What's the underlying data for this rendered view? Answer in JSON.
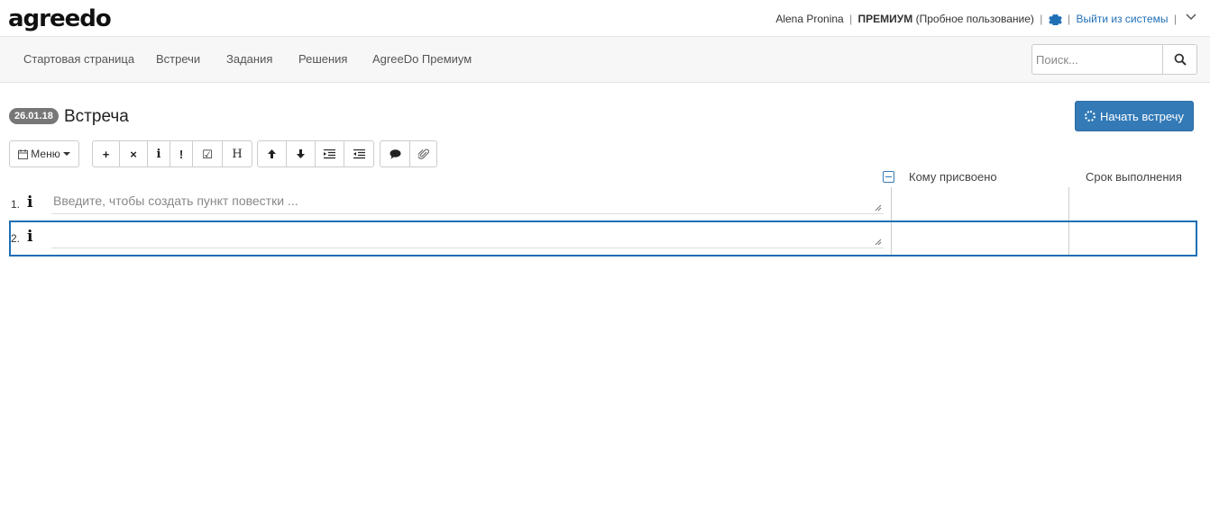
{
  "app": {
    "logo_text": "agreedo"
  },
  "user_bar": {
    "user_name": "Alena Pronina",
    "sep": "|",
    "plan": "ПРЕМИУМ",
    "plan_note": "(Пробное пользование)",
    "logout_label": "Выйти из системы",
    "settings_icon": "gear-icon",
    "menu_icon": "chevron-down-icon"
  },
  "nav": {
    "items": [
      {
        "label": "Стартовая страница"
      },
      {
        "label": "Встречи"
      },
      {
        "label": "Задания"
      },
      {
        "label": "Решения"
      },
      {
        "label": "AgreeDo Премиум"
      }
    ],
    "search_placeholder": "Поиск...",
    "search_icon": "search-icon"
  },
  "meeting": {
    "date_badge": "26.01.18",
    "title": "Встреча",
    "start_button_label": "Начать встречу"
  },
  "toolbar": {
    "menu_label": "Меню",
    "buttons": [
      {
        "icon": "plus-icon",
        "glyph": "+"
      },
      {
        "icon": "remove-icon",
        "glyph": "×"
      },
      {
        "icon": "info-icon",
        "glyph": "i"
      },
      {
        "icon": "exclamation-icon",
        "glyph": "!"
      },
      {
        "icon": "checkbox-icon",
        "glyph": "☑"
      },
      {
        "icon": "heading-icon",
        "glyph": "H"
      },
      {
        "icon": "arrow-up-icon",
        "glyph": "🡑"
      },
      {
        "icon": "arrow-down-icon",
        "glyph": "🡓"
      },
      {
        "icon": "indent-icon",
        "glyph": "⇥"
      },
      {
        "icon": "outdent-icon",
        "glyph": "⇤"
      },
      {
        "icon": "comment-icon",
        "glyph": "💬"
      },
      {
        "icon": "paperclip-icon",
        "glyph": "📎"
      }
    ]
  },
  "table": {
    "headers": {
      "assigned_to": "Кому присвоено",
      "due_date": "Срок выполнения"
    },
    "rows": [
      {
        "num": "1.",
        "icon_glyph": "i",
        "placeholder": "Введите, чтобы создать пункт повестки ...",
        "value": "",
        "assigned_to": "",
        "due_date": ""
      },
      {
        "num": "2.",
        "icon_glyph": "i",
        "placeholder": "",
        "value": "",
        "assigned_to": "",
        "due_date": ""
      }
    ]
  },
  "colors": {
    "accent": "#337ab7",
    "badge": "#777777",
    "link": "#1f6fb5"
  }
}
